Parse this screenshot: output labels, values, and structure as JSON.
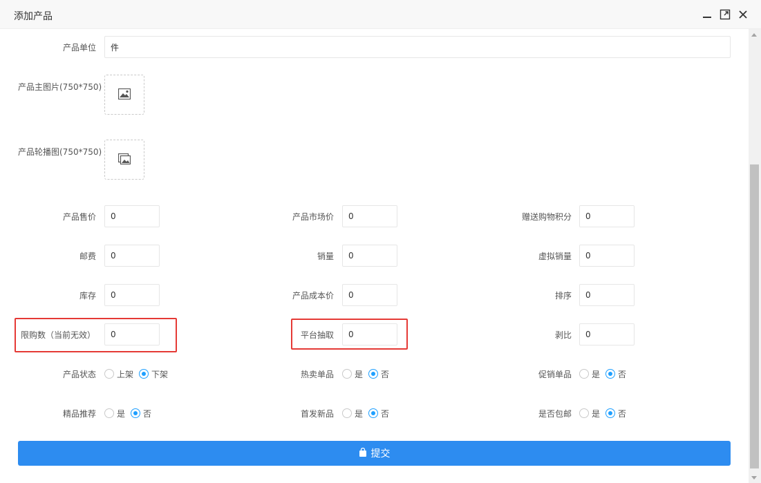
{
  "dialog": {
    "title": "添加产品"
  },
  "form": {
    "unit": {
      "label": "产品单位",
      "value": "件"
    },
    "main_image": {
      "label": "产品主图片(750*750)"
    },
    "carousel": {
      "label": "产品轮播图(750*750)"
    },
    "price": {
      "label": "产品售价",
      "value": "0"
    },
    "market_price": {
      "label": "产品市场价",
      "value": "0"
    },
    "gift_points": {
      "label": "赠送购物积分",
      "value": "0"
    },
    "postage": {
      "label": "邮费",
      "value": "0"
    },
    "sales": {
      "label": "销量",
      "value": "0"
    },
    "virtual_sales": {
      "label": "虚拟销量",
      "value": "0"
    },
    "stock": {
      "label": "库存",
      "value": "0"
    },
    "cost": {
      "label": "产品成本价",
      "value": "0"
    },
    "sort": {
      "label": "排序",
      "value": "0"
    },
    "limit": {
      "label": "限购数（当前无效）",
      "value": "0"
    },
    "platform_fee": {
      "label": "平台抽取",
      "value": "0"
    },
    "ratio": {
      "label": "剥比",
      "value": "0"
    },
    "status": {
      "label": "产品状态",
      "on": "上架",
      "off": "下架",
      "selected": "下架"
    },
    "hot": {
      "label": "热卖单品",
      "yes": "是",
      "no": "否",
      "selected": "否"
    },
    "promo": {
      "label": "促销单品",
      "yes": "是",
      "no": "否",
      "selected": "否"
    },
    "recommend": {
      "label": "精品推荐",
      "yes": "是",
      "no": "否",
      "selected": "否"
    },
    "new_release": {
      "label": "首发新品",
      "yes": "是",
      "no": "否",
      "selected": "否"
    },
    "free_shipping": {
      "label": "是否包邮",
      "yes": "是",
      "no": "否",
      "selected": "否"
    }
  },
  "submit": {
    "label": "提交"
  },
  "colors": {
    "accent": "#1e9fff",
    "button": "#2d8cf0",
    "highlight": "#e53935"
  }
}
